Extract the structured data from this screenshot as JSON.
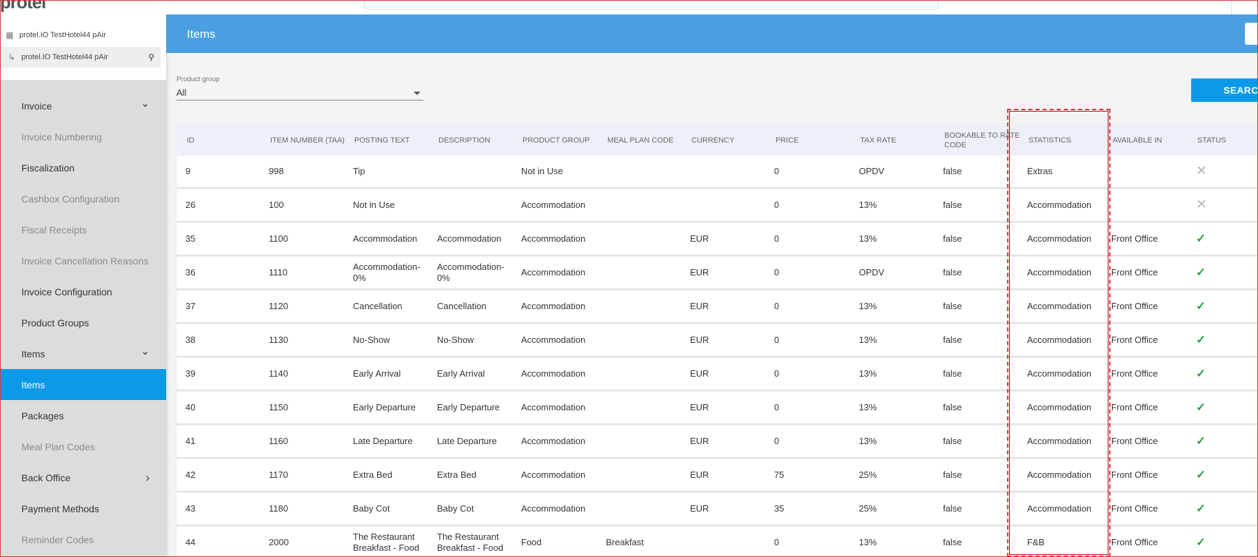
{
  "brand": {
    "logo_text": "protel"
  },
  "hotel": {
    "property_name": "protel.IO TestHotel44 pAir",
    "selected_name": "protel.IO TestHotel44 pAir"
  },
  "sidebar": {
    "items": [
      {
        "label": "Invoice",
        "state": "expandable-open",
        "style": "normal"
      },
      {
        "label": "Invoice Numbering",
        "style": "muted"
      },
      {
        "label": "Fiscalization",
        "style": "normal"
      },
      {
        "label": "Cashbox Configuration",
        "style": "muted"
      },
      {
        "label": "Fiscal Receipts",
        "style": "muted"
      },
      {
        "label": "Invoice Cancellation Reasons",
        "style": "muted"
      },
      {
        "label": "Invoice Configuration",
        "style": "normal"
      },
      {
        "label": "Product Groups",
        "style": "normal"
      },
      {
        "label": "Items",
        "state": "expandable-open",
        "style": "normal"
      },
      {
        "label": "Items",
        "style": "active"
      },
      {
        "label": "Packages",
        "style": "normal"
      },
      {
        "label": "Meal Plan Codes",
        "style": "muted"
      },
      {
        "label": "Back Office",
        "state": "expandable-closed",
        "style": "normal"
      },
      {
        "label": "Payment Methods",
        "style": "normal"
      },
      {
        "label": "Reminder Codes",
        "style": "muted"
      }
    ]
  },
  "header": {
    "title": "Items"
  },
  "filter": {
    "label": "Product group",
    "value": "All"
  },
  "search_button": {
    "label": "SEARCH"
  },
  "table": {
    "columns": [
      "ID",
      "ITEM NUMBER (TAA)",
      "POSTING TEXT",
      "DESCRIPTION",
      "PRODUCT GROUP",
      "MEAL PLAN CODE",
      "CURRENCY",
      "PRICE",
      "TAX RATE",
      "BOOKABLE TO RATE CODE",
      "STATISTICS",
      "AVAILABLE IN",
      "STATUS"
    ],
    "rows": [
      [
        "9",
        "998",
        "Tip",
        "",
        "Not in Use",
        "",
        "",
        "0",
        "OPDV",
        "false",
        "Extras",
        "",
        "inactive"
      ],
      [
        "26",
        "100",
        "Not in Use",
        "",
        "Accommodation",
        "",
        "",
        "0",
        "13%",
        "false",
        "Accommodation",
        "",
        "inactive"
      ],
      [
        "35",
        "1100",
        "Accommodation",
        "Accommodation",
        "Accommodation",
        "",
        "EUR",
        "0",
        "13%",
        "false",
        "Accommodation",
        "Front Office",
        "active"
      ],
      [
        "36",
        "1110",
        "Accommodation-0%",
        "Accommodation-0%",
        "Accommodation",
        "",
        "EUR",
        "0",
        "OPDV",
        "false",
        "Accommodation",
        "Front Office",
        "active"
      ],
      [
        "37",
        "1120",
        "Cancellation",
        "Cancellation",
        "Accommodation",
        "",
        "EUR",
        "0",
        "13%",
        "false",
        "Accommodation",
        "Front Office",
        "active"
      ],
      [
        "38",
        "1130",
        "No-Show",
        "No-Show",
        "Accommodation",
        "",
        "EUR",
        "0",
        "13%",
        "false",
        "Accommodation",
        "Front Office",
        "active"
      ],
      [
        "39",
        "1140",
        "Early Arrival",
        "Early Arrival",
        "Accommodation",
        "",
        "EUR",
        "0",
        "13%",
        "false",
        "Accommodation",
        "Front Office",
        "active"
      ],
      [
        "40",
        "1150",
        "Early Departure",
        "Early Departure",
        "Accommodation",
        "",
        "EUR",
        "0",
        "13%",
        "false",
        "Accommodation",
        "Front Office",
        "active"
      ],
      [
        "41",
        "1160",
        "Late Departure",
        "Late Departure",
        "Accommodation",
        "",
        "EUR",
        "0",
        "13%",
        "false",
        "Accommodation",
        "Front Office",
        "active"
      ],
      [
        "42",
        "1170",
        "Extra Bed",
        "Extra Bed",
        "Accommodation",
        "",
        "EUR",
        "75",
        "25%",
        "false",
        "Accommodation",
        "Front Office",
        "active"
      ],
      [
        "43",
        "1180",
        "Baby Cot",
        "Baby Cot",
        "Accommodation",
        "",
        "EUR",
        "35",
        "25%",
        "false",
        "Accommodation",
        "Front Office",
        "active"
      ],
      [
        "44",
        "2000",
        "The Restaurant Breakfast - Food",
        "The Restaurant Breakfast - Food",
        "Food",
        "Breakfast",
        "",
        "0",
        "13%",
        "false",
        "F&B",
        "Front Office",
        "active"
      ]
    ]
  },
  "colors": {
    "accent": "#0a9ae8",
    "header": "#4a9fe0",
    "sidebar": "#dcdcdc",
    "ok": "#2e9e48",
    "highlight": "#e0303a"
  }
}
